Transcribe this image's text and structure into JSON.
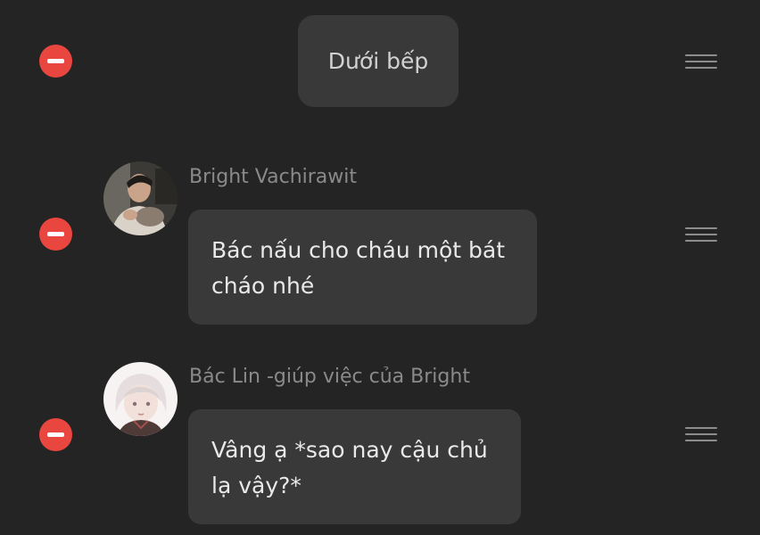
{
  "scene": {
    "title": "Dưới bếp"
  },
  "messages": [
    {
      "sender": "Bright Vachirawit",
      "lines": [
        "Bác nấu cho cháu một bát",
        "cháo nhé"
      ],
      "avatar": "young-man-photo"
    },
    {
      "sender": "Bác Lin -giúp việc của Bright",
      "lines": [
        "Vâng ạ *sao nay cậu chủ",
        "lạ vậy?*"
      ],
      "avatar": "white-haired-girl-illustration"
    }
  ],
  "icons": {
    "remove": "minus-circle-icon",
    "reorder": "drag-handle-icon"
  },
  "colors": {
    "background": "#242424",
    "bubble": "#393939",
    "remove": "#e9463f",
    "sender_text": "#8a8a8a",
    "message_text": "#e9e9e9"
  }
}
